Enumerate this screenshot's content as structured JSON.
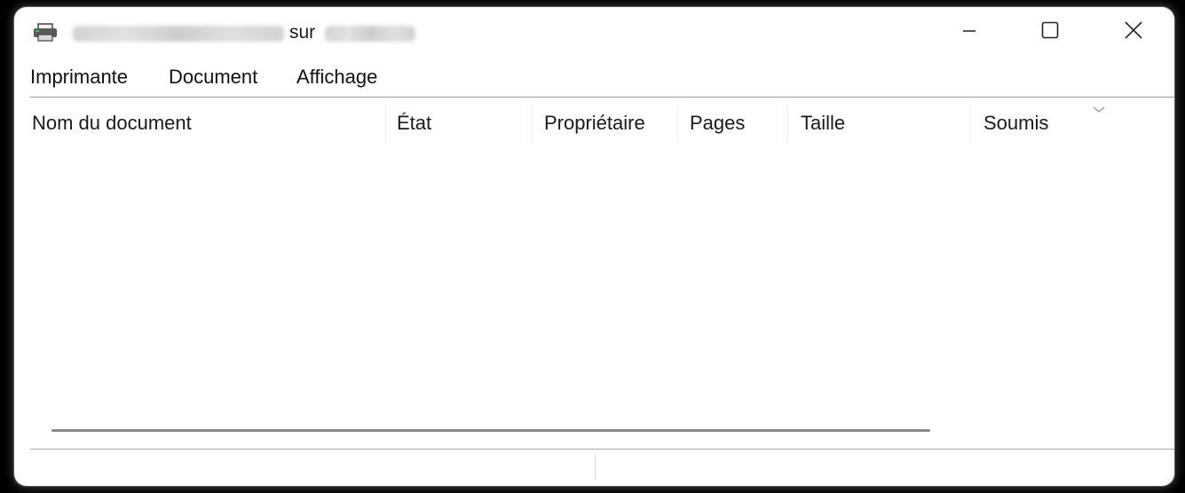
{
  "window": {
    "title_connector": "sur",
    "icon": "printer-icon"
  },
  "controls": {
    "minimize_icon": "minimize-icon",
    "maximize_icon": "maximize-icon",
    "close_icon": "close-icon"
  },
  "menu": {
    "items": [
      "Imprimante",
      "Document",
      "Affichage"
    ]
  },
  "table": {
    "columns": [
      "Nom du document",
      "État",
      "Propriétaire",
      "Pages",
      "Taille",
      "Soumis"
    ],
    "sort_icon": "chevron-down-icon",
    "rows": []
  },
  "colors": {
    "background": "#000000",
    "window": "#ffffff",
    "text": "#1a1a1a"
  }
}
